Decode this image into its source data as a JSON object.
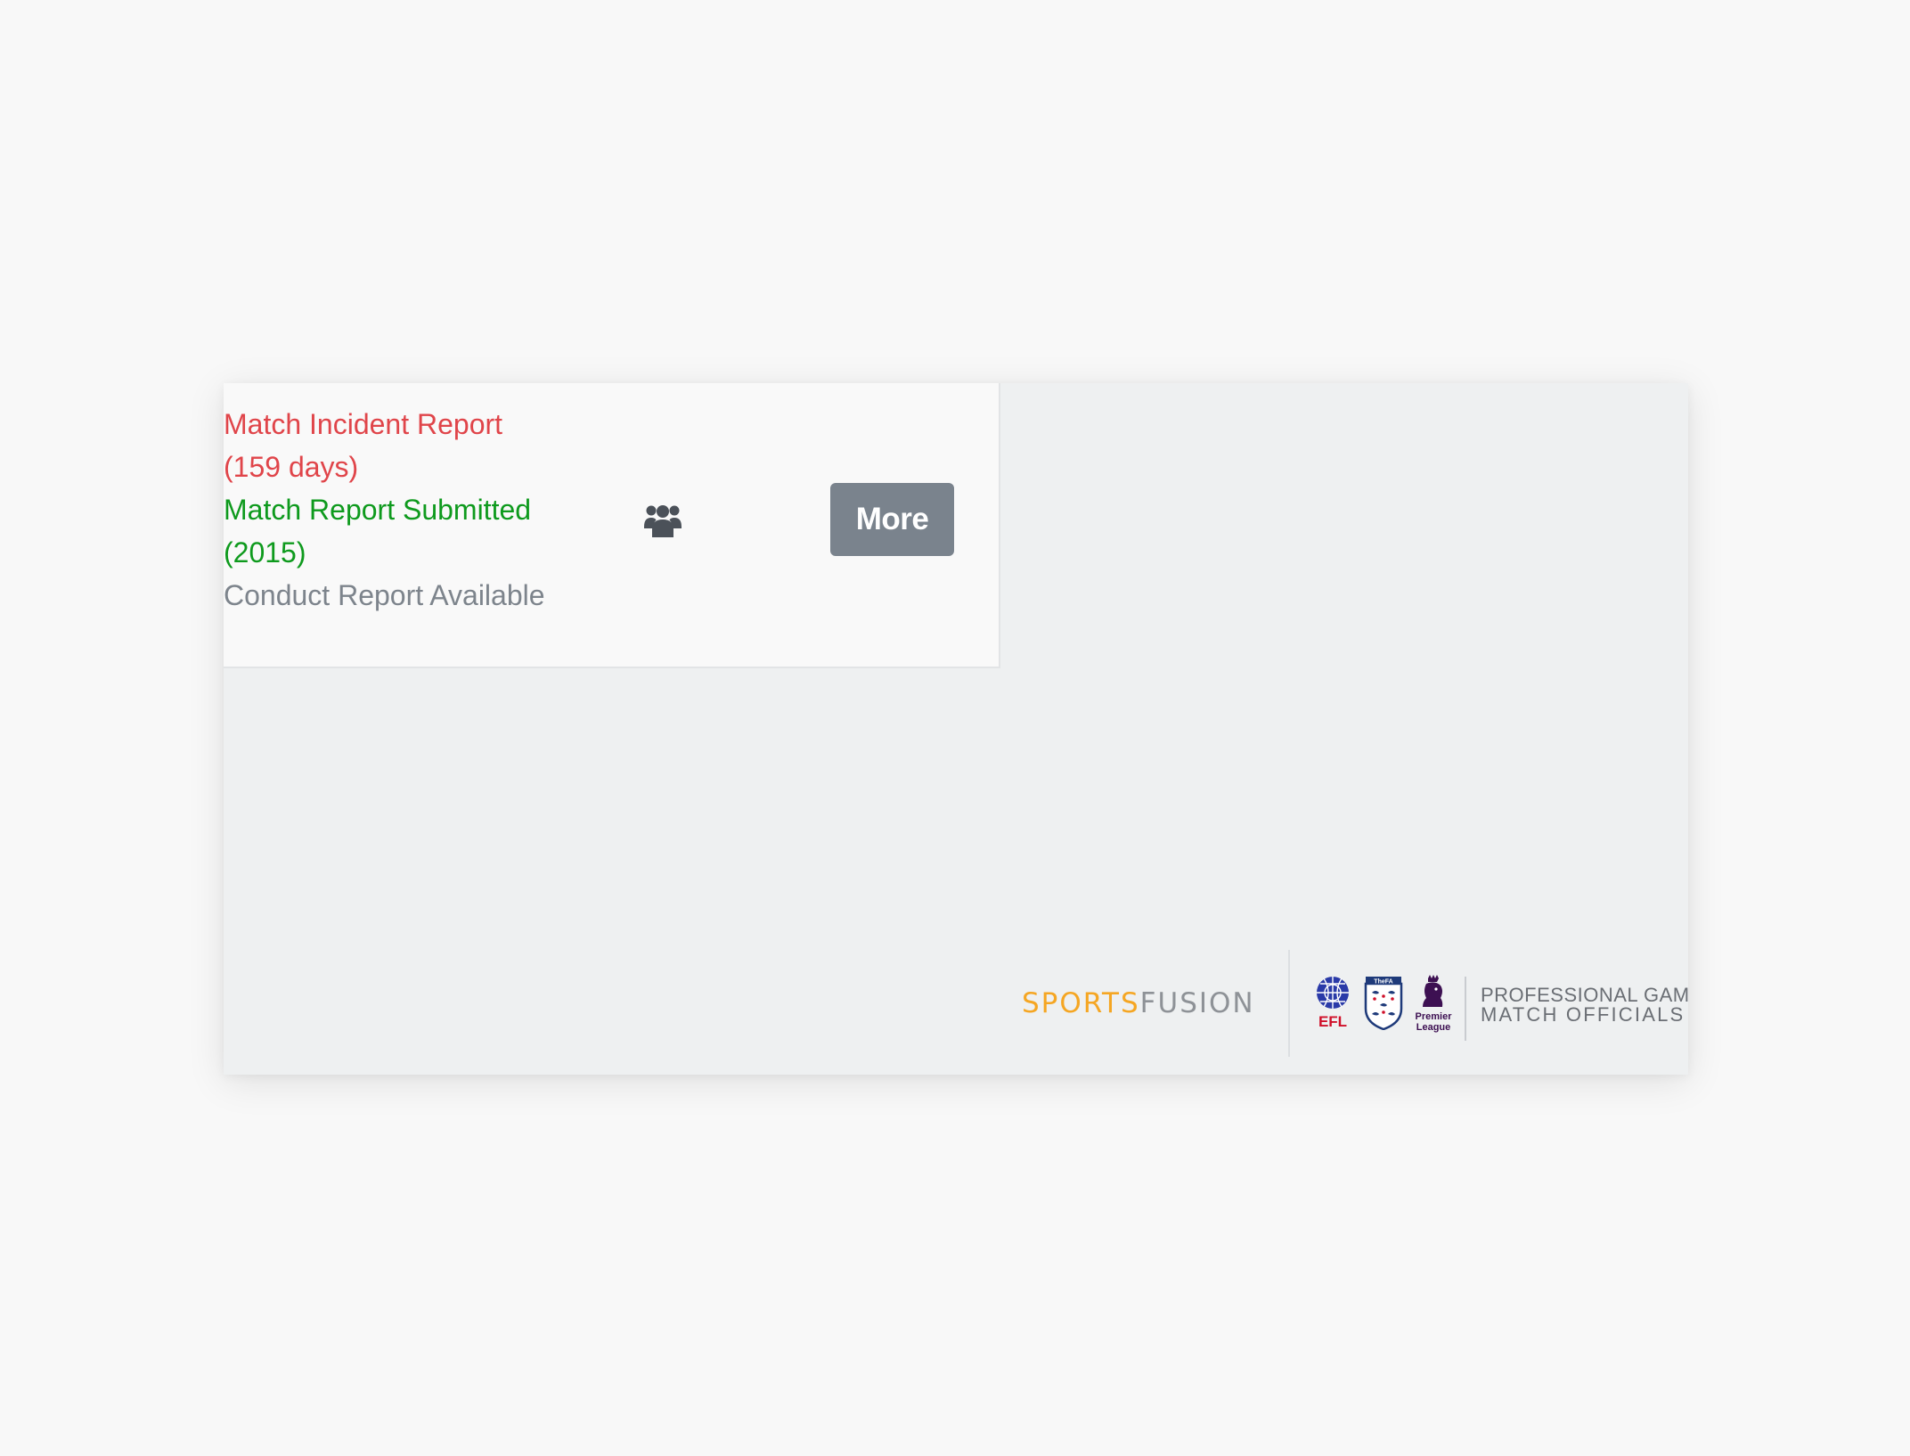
{
  "fixture": {
    "statuses": [
      {
        "text": "Match Incident Report",
        "color": "#e0454a"
      },
      {
        "text": "(159 days)",
        "color": "#e0454a"
      },
      {
        "text": "Match Report Submitted",
        "color": "#0e9a1d"
      },
      {
        "text": "(2015)",
        "color": "#0e9a1d"
      },
      {
        "text": "Conduct Report Available",
        "color": "#7d848c"
      }
    ],
    "officials_icon": "users-icon",
    "more_label": "More"
  },
  "footer": {
    "brand_part1": "SPORTS",
    "brand_part2": "FUSION",
    "efl_label": "EFL",
    "fa_label": "TheFA",
    "pl_label_1": "Premier",
    "pl_label_2": "League",
    "pgmo_line1": "PROFESSIONAL GAME",
    "pgmo_line2": "MATCH OFFICIALS"
  },
  "colors": {
    "accent_orange": "#f5a623",
    "button_grey": "#7a838d",
    "status_red": "#e0454a",
    "status_green": "#0e9a1d"
  }
}
